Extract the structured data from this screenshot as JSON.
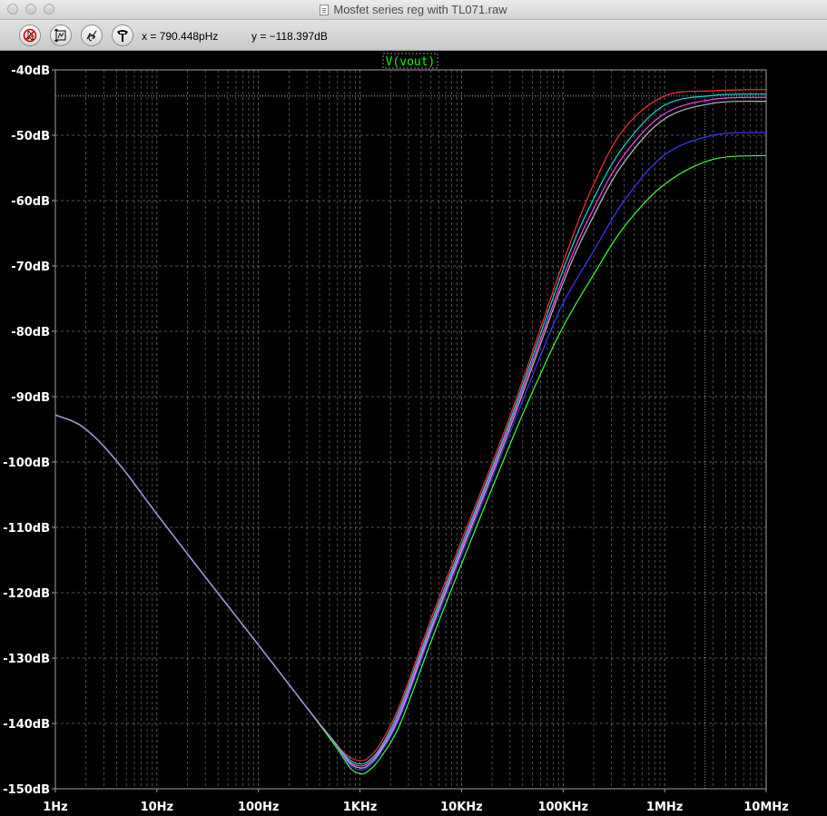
{
  "window": {
    "title": "Mosfet series reg with TL071.raw"
  },
  "toolbar": {
    "buttons": [
      {
        "name": "no-pointer-tool-button",
        "icon": "no-pointer-icon"
      },
      {
        "name": "autoscale-button",
        "icon": "autoscale-icon"
      },
      {
        "name": "zoom-undo-button",
        "icon": "zoom-back-icon"
      },
      {
        "name": "probe-button",
        "icon": "probe-icon"
      }
    ],
    "cursor_x": "x = 790.448pHz",
    "cursor_y": "y = −118.397dB"
  },
  "colors": {
    "background": "#000000",
    "grid": "#808080",
    "trace_label": "#00ff00"
  },
  "chart_data": {
    "type": "line",
    "trace_label": "V(vout)",
    "x_scale": "log",
    "xlim": [
      1,
      10000000
    ],
    "ylim": [
      -150,
      -40
    ],
    "x_ticks": [
      {
        "value": 1,
        "label": "1Hz"
      },
      {
        "value": 10,
        "label": "10Hz"
      },
      {
        "value": 100,
        "label": "100Hz"
      },
      {
        "value": 1000,
        "label": "1KHz"
      },
      {
        "value": 10000,
        "label": "10KHz"
      },
      {
        "value": 100000,
        "label": "100KHz"
      },
      {
        "value": 1000000,
        "label": "1MHz"
      },
      {
        "value": 10000000,
        "label": "10MHz"
      }
    ],
    "y_ticks": [
      {
        "value": -40,
        "label": "-40dB"
      },
      {
        "value": -50,
        "label": "-50dB"
      },
      {
        "value": -60,
        "label": "-60dB"
      },
      {
        "value": -70,
        "label": "-70dB"
      },
      {
        "value": -80,
        "label": "-80dB"
      },
      {
        "value": -90,
        "label": "-90dB"
      },
      {
        "value": -100,
        "label": "-100dB"
      },
      {
        "value": -110,
        "label": "-110dB"
      },
      {
        "value": -120,
        "label": "-120dB"
      },
      {
        "value": -130,
        "label": "-130dB"
      },
      {
        "value": -140,
        "label": "-140dB"
      },
      {
        "value": -150,
        "label": "-150dB"
      }
    ],
    "grid": true,
    "cursor_line": {
      "y": -44,
      "x_end": 2500000
    },
    "common_curve": {
      "color": "#b48ad8",
      "x": [
        1,
        1.5,
        2,
        3,
        5,
        10,
        30,
        100,
        300,
        600
      ],
      "y": [
        -92.8,
        -93.8,
        -95.0,
        -97.6,
        -101.7,
        -108.0,
        -117.6,
        -128.0,
        -137.6,
        -143.4
      ]
    },
    "series": [
      {
        "color": "#ff3030",
        "x": [
          600,
          800,
          1000,
          1200,
          1600,
          2500,
          5000,
          10000,
          30000,
          100000,
          200000,
          400000,
          1000000,
          3000000,
          10000000
        ],
        "y": [
          -143.4,
          -145.2,
          -145.7,
          -145.3,
          -143.0,
          -136.9,
          -124.0,
          -112.0,
          -93.0,
          -69.5,
          -57.5,
          -49.0,
          -44.0,
          -43.2,
          -43.0
        ]
      },
      {
        "color": "#00e0d0",
        "x": [
          600,
          800,
          1000,
          1200,
          1600,
          2500,
          5000,
          10000,
          30000,
          100000,
          200000,
          400000,
          1000000,
          3000000,
          10000000
        ],
        "y": [
          -143.5,
          -145.6,
          -146.2,
          -145.8,
          -143.6,
          -137.5,
          -124.7,
          -112.7,
          -93.7,
          -70.6,
          -59.7,
          -51.6,
          -45.4,
          -43.9,
          -43.7
        ]
      },
      {
        "color": "#ff40ff",
        "x": [
          600,
          800,
          1000,
          1200,
          1600,
          2500,
          5000,
          10000,
          30000,
          100000,
          200000,
          400000,
          1000000,
          3000000,
          10000000
        ],
        "y": [
          -143.6,
          -145.9,
          -146.5,
          -146.1,
          -143.9,
          -138.0,
          -125.2,
          -113.2,
          -94.2,
          -71.8,
          -61.2,
          -53.0,
          -46.7,
          -44.5,
          -44.2
        ]
      },
      {
        "color": "#bbbbbb",
        "x": [
          600,
          800,
          1000,
          1200,
          1600,
          2500,
          5000,
          10000,
          30000,
          100000,
          200000,
          400000,
          1000000,
          3000000,
          10000000
        ],
        "y": [
          -143.7,
          -146.1,
          -146.8,
          -146.4,
          -144.2,
          -138.5,
          -125.7,
          -113.7,
          -94.8,
          -72.6,
          -62.3,
          -54.1,
          -47.5,
          -45.1,
          -44.8
        ]
      },
      {
        "color": "#3a3aff",
        "x": [
          600,
          800,
          1000,
          1200,
          1600,
          2500,
          5000,
          10000,
          30000,
          60000,
          100000,
          200000,
          400000,
          1000000,
          3000000,
          10000000
        ],
        "y": [
          -143.8,
          -146.4,
          -147.1,
          -146.7,
          -144.5,
          -138.9,
          -126.2,
          -114.3,
          -95.5,
          -83.7,
          -75.7,
          -67.7,
          -60.0,
          -53.0,
          -50.0,
          -49.6
        ]
      },
      {
        "color": "#3cff3c",
        "x": [
          600,
          800,
          1000,
          1200,
          1600,
          2500,
          5000,
          10000,
          30000,
          60000,
          100000,
          200000,
          400000,
          1000000,
          3000000,
          10000000
        ],
        "y": [
          -143.9,
          -146.8,
          -147.7,
          -147.3,
          -145.2,
          -140.0,
          -127.5,
          -115.6,
          -97.3,
          -86.5,
          -79.3,
          -71.3,
          -64.0,
          -57.5,
          -53.7,
          -53.1
        ]
      }
    ]
  }
}
